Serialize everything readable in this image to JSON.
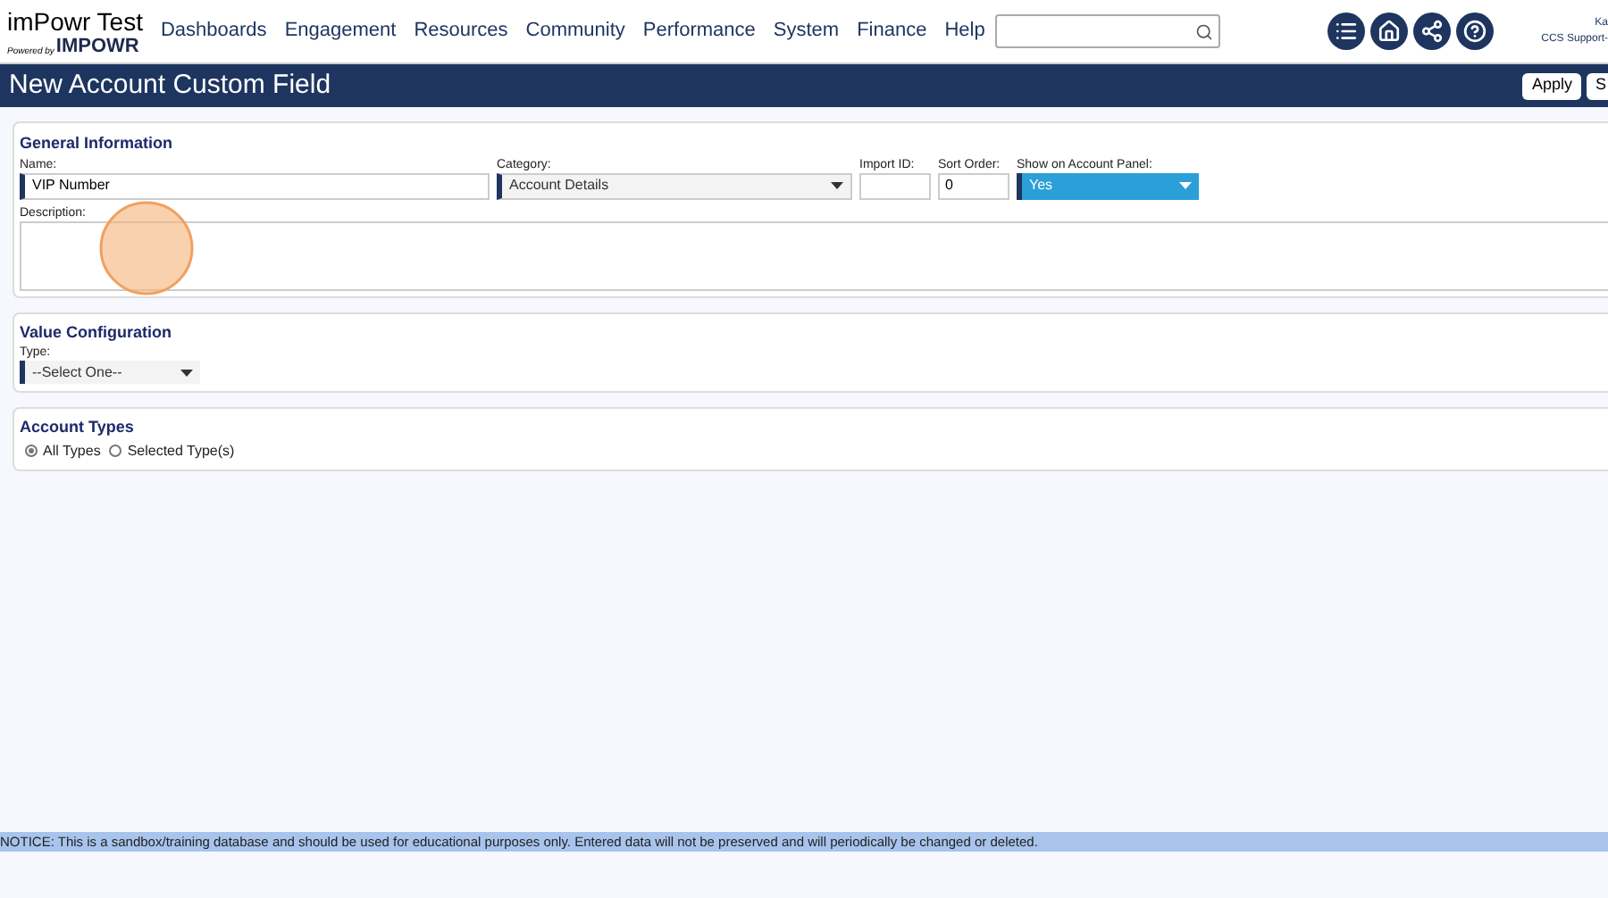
{
  "logo": {
    "title": "imPowr Test",
    "powered_by": "Powered by",
    "brand": "IMPOWR"
  },
  "nav": [
    "Dashboards",
    "Engagement",
    "Resources",
    "Community",
    "Performance",
    "System",
    "Finance",
    "Help"
  ],
  "user": {
    "name": "Ka",
    "role": "CCS Support-"
  },
  "page_title": "New Account Custom Field",
  "actions": [
    "Apply",
    "S"
  ],
  "general": {
    "title": "General Information",
    "name": {
      "label": "Name:",
      "value": "VIP Number"
    },
    "category": {
      "label": "Category:",
      "value": "Account Details"
    },
    "import_id": {
      "label": "Import ID:"
    },
    "sort_order": {
      "label": "Sort Order:",
      "value": "0"
    },
    "show_on_panel": {
      "label": "Show on Account Panel:",
      "value": "Yes"
    },
    "description": {
      "label": "Description:"
    }
  },
  "value_config": {
    "title": "Value Configuration",
    "type": {
      "label": "Type:",
      "value": "--Select One--"
    }
  },
  "account_types": {
    "title": "Account Types",
    "options": [
      {
        "label": "All Types",
        "selected": true
      },
      {
        "label": "Selected Type(s)",
        "selected": false
      }
    ]
  },
  "notice": "NOTICE: This is a sandbox/training database and should be used for educational purposes only. Entered data will not be preserved and will periodically be changed or deleted."
}
